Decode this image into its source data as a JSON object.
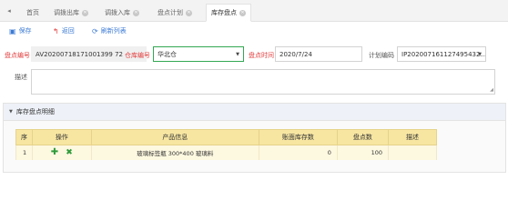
{
  "tabs": [
    {
      "label": "首页",
      "closable": false,
      "active": false
    },
    {
      "label": "调拨出库",
      "closable": true,
      "active": false
    },
    {
      "label": "调拨入库",
      "closable": true,
      "active": false
    },
    {
      "label": "盘点计划",
      "closable": true,
      "active": false
    },
    {
      "label": "库存盘点",
      "closable": true,
      "active": true
    }
  ],
  "toolbar": {
    "save_label": "保存",
    "back_label": "返回",
    "refresh_label": "刷新列表"
  },
  "form": {
    "number_label": "盘点编号",
    "number_value": "AV20200718171001399 72",
    "warehouse_label": "仓库编号",
    "warehouse_value": "华北仓",
    "time_label": "盘点时间",
    "time_value": "2020/7/24",
    "plan_label": "计划编码",
    "plan_value": "IP202007161127495432...",
    "desc_label": "描述",
    "desc_value": ""
  },
  "panel": {
    "title": "库存盘点明细"
  },
  "grid": {
    "columns": [
      "序",
      "操作",
      "产品信息",
      "账面库存数",
      "盘点数",
      "描述"
    ],
    "rows": [
      {
        "index": "1",
        "product": "玻璃标签瓶 300*400 玻璃料",
        "book_qty": "0",
        "count_qty": "100",
        "desc": ""
      }
    ]
  },
  "colors": {
    "accent_blue": "#3d7bd5",
    "required_red": "#e23b3b",
    "grid_header": "#f7e6a2",
    "grid_row": "#fdf8e0",
    "action_green": "#2e9b3a"
  }
}
